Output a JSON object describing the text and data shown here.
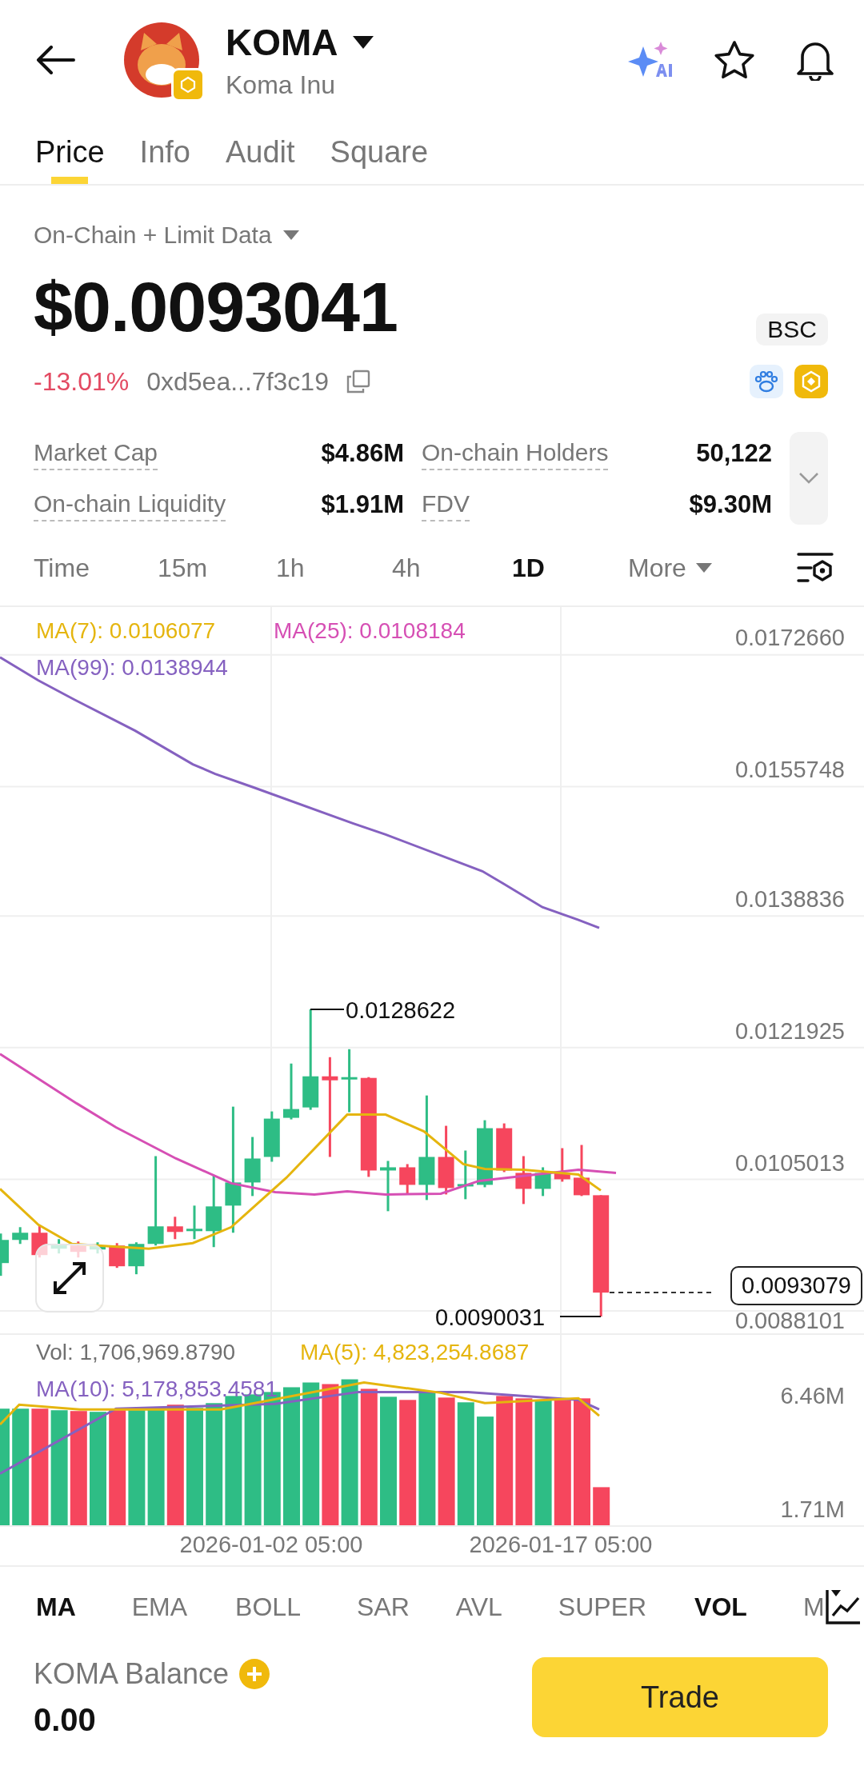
{
  "header": {
    "symbol": "KOMA",
    "name": "Koma Inu"
  },
  "tabs": [
    {
      "label": "Price",
      "selected": true
    },
    {
      "label": "Info",
      "selected": false
    },
    {
      "label": "Audit",
      "selected": false
    },
    {
      "label": "Square",
      "selected": false
    }
  ],
  "data_source": "On-Chain + Limit Data",
  "price": "$0.0093041",
  "network": "BSC",
  "change": "-13.01%",
  "address": "0xd5ea...7f3c19",
  "stats": [
    {
      "label": "Market Cap",
      "value": "$4.86M"
    },
    {
      "label": "On-chain Holders",
      "value": "50,122"
    },
    {
      "label": "On-chain Liquidity",
      "value": "$1.91M"
    },
    {
      "label": "FDV",
      "value": "$9.30M"
    }
  ],
  "intervals": [
    {
      "label": "Time",
      "selected": false
    },
    {
      "label": "15m",
      "selected": false
    },
    {
      "label": "1h",
      "selected": false
    },
    {
      "label": "4h",
      "selected": false
    },
    {
      "label": "1D",
      "selected": true
    }
  ],
  "more_menu": "More",
  "chart": {
    "legend": [
      {
        "text": "MA(7): 0.0106077",
        "color": "#e5b50e"
      },
      {
        "text": "MA(25): 0.0108184",
        "color": "#d64fb4"
      },
      {
        "text": "MA(99): 0.0138944",
        "color": "#8561c0"
      }
    ],
    "y_labels": [
      "0.0172660",
      "0.0155748",
      "0.0138836",
      "0.0121925",
      "0.0105013",
      "0.0088101"
    ],
    "high_label": "0.0128622",
    "low_label": "0.0090031",
    "last_price": "0.0093079"
  },
  "volume": {
    "legend": [
      {
        "text": "Vol: 1,706,969.8790",
        "color": "#707070"
      },
      {
        "text": "MA(5): 4,823,254.8687",
        "color": "#e5b50e"
      },
      {
        "text": "MA(10): 5,178,853.4581",
        "color": "#8561c0"
      }
    ],
    "y_labels": [
      "6.46M",
      "1.71M"
    ]
  },
  "dates": [
    "2026-01-02 05:00",
    "2026-01-17 05:00"
  ],
  "indicators": [
    {
      "label": "MA",
      "selected": true,
      "kind": "main"
    },
    {
      "label": "EMA",
      "selected": false,
      "kind": "main"
    },
    {
      "label": "BOLL",
      "selected": false,
      "kind": "main"
    },
    {
      "label": "SAR",
      "selected": false,
      "kind": "main"
    },
    {
      "label": "AVL",
      "selected": false,
      "kind": "main"
    },
    {
      "label": "SUPER",
      "selected": false,
      "kind": "main"
    },
    {
      "label": "VOL",
      "selected": true,
      "kind": "sub"
    },
    {
      "label": "M",
      "selected": false,
      "kind": "sub"
    }
  ],
  "balance": {
    "label": "KOMA Balance",
    "value": "0.00"
  },
  "trade_button": "Trade"
}
